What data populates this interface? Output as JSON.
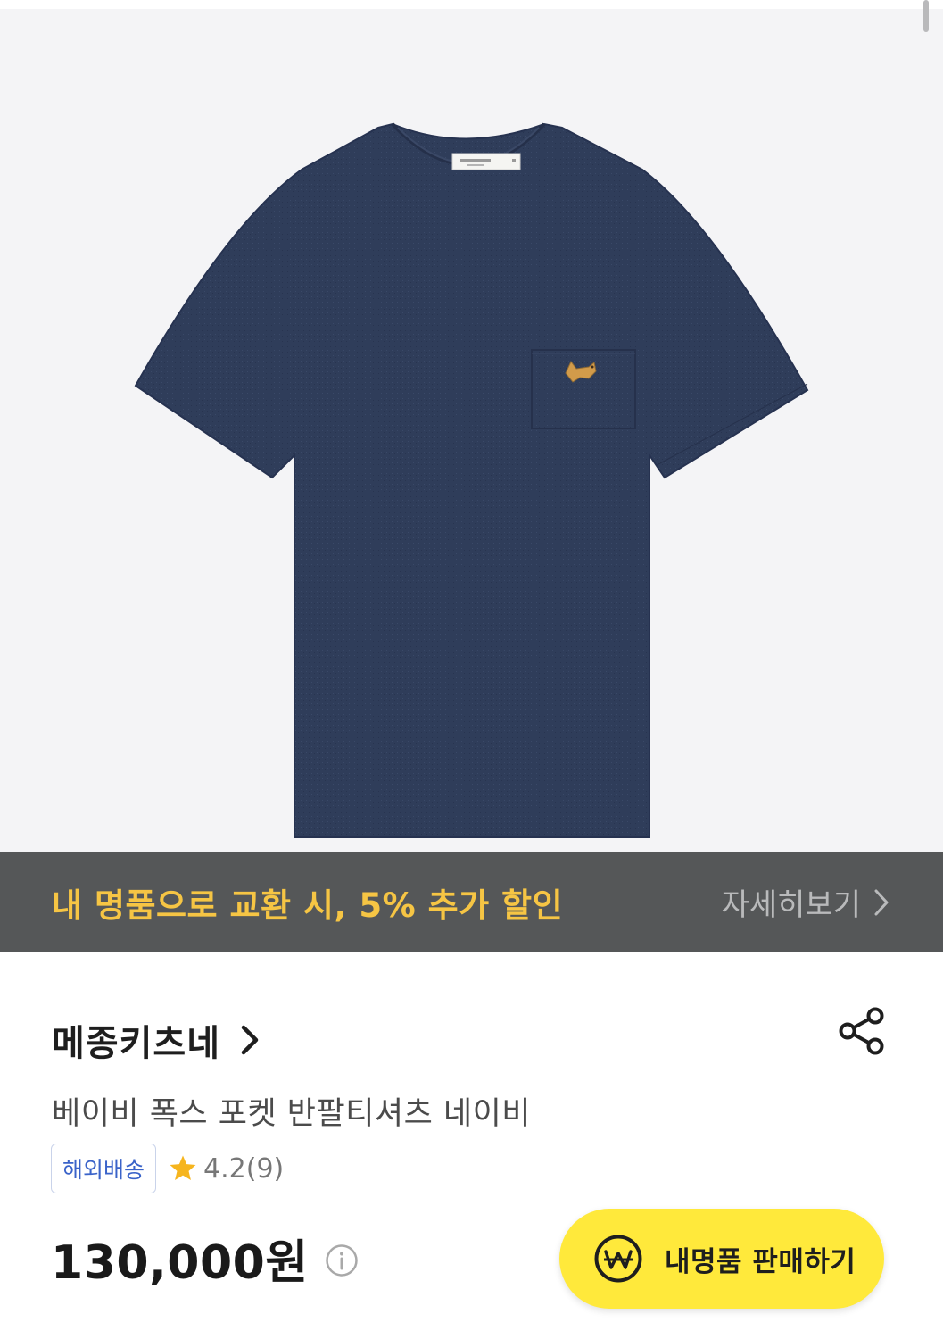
{
  "promo": {
    "text": "내 명품으로 교환 시, 5% 추가 할인",
    "more_label": "자세히보기"
  },
  "product": {
    "brand": "메종키츠네",
    "name": "베이비 폭스 포켓 반팔티셔츠 네이비",
    "shipping_tag": "해외배송",
    "rating": "4.2",
    "review_count": "(9)",
    "price": "130,000원"
  },
  "sell_button": {
    "label": "내명품 판매하기"
  },
  "colors": {
    "hero_bg": "#f4f4f6",
    "shirt": "#2f3d5a",
    "promo_bg": "#555758",
    "promo_text": "#f6c544",
    "sell_button": "#ffe93b",
    "tag_text": "#3a63c9",
    "star": "#f6b51e"
  },
  "icons": [
    "chevron-right-icon",
    "share-icon",
    "star-icon",
    "info-icon",
    "won-coin-icon"
  ]
}
